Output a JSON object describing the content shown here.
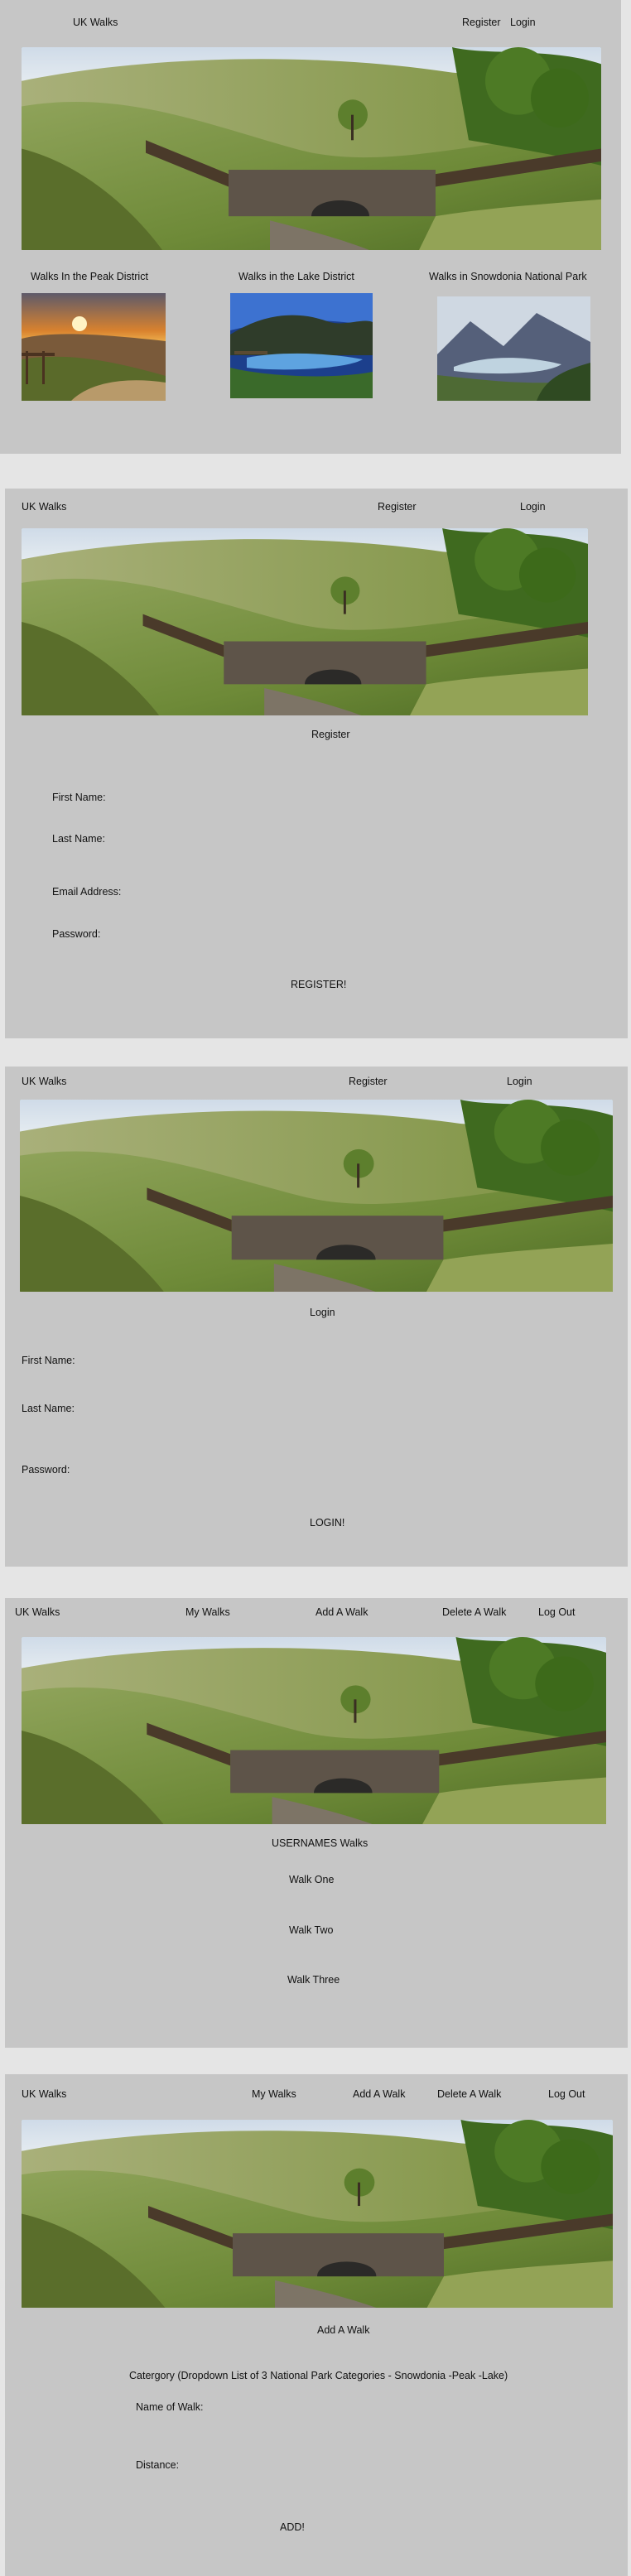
{
  "wire1": {
    "nav": {
      "brand": "UK Walks",
      "register": "Register",
      "login": "Login"
    },
    "cards": [
      {
        "label": "Walks In the Peak District"
      },
      {
        "label": "Walks in the Lake District"
      },
      {
        "label": "Walks in Snowdonia National Park"
      }
    ]
  },
  "wire2": {
    "nav": {
      "brand": "UK Walks",
      "register": "Register",
      "login": "Login"
    },
    "title": "Register",
    "fields": {
      "first": "First Name:",
      "last": "Last Name:",
      "email": "Email Address:",
      "password": "Password:"
    },
    "submit": "REGISTER!"
  },
  "wire3": {
    "nav": {
      "brand": "UK Walks",
      "register": "Register",
      "login": "Login"
    },
    "title": "Login",
    "fields": {
      "first": "First Name:",
      "last": "Last Name:",
      "password": "Password:"
    },
    "submit": "LOGIN!"
  },
  "wire4": {
    "nav": {
      "brand": "UK Walks",
      "my": "My Walks",
      "add": "Add A Walk",
      "del": "Delete A Walk",
      "logout": "Log Out"
    },
    "title": "USERNAMES Walks",
    "walks": [
      "Walk One",
      "Walk Two",
      "Walk Three"
    ]
  },
  "wire5": {
    "nav": {
      "brand": "UK Walks",
      "my": "My Walks",
      "add": "Add A Walk",
      "del": "Delete A Walk",
      "logout": "Log Out"
    },
    "title": "Add A Walk",
    "category": "Catergory (Dropdown List of 3 National Park Categories - Snowdonia -Peak -Lake)",
    "fields": {
      "name": "Name of Walk:",
      "distance": "Distance:"
    },
    "submit": "ADD!"
  },
  "colors": {
    "panel": "#c6c6c6",
    "page": "#e5e5e5",
    "sky": "#9fb8d4",
    "grass": "#6f8e3a",
    "stone": "#5b5146"
  }
}
